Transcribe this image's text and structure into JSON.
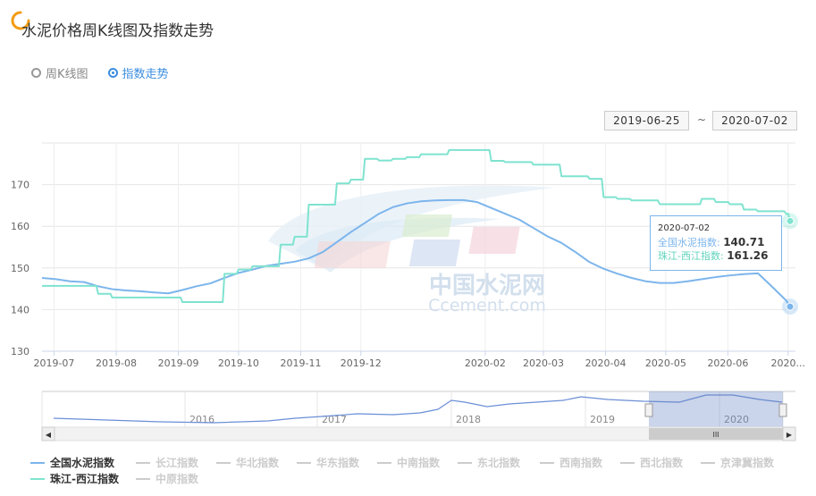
{
  "page": {
    "title": "水泥价格周K线图及指数走势",
    "radios": [
      {
        "label": "周K线图",
        "active": false
      },
      {
        "label": "指数走势",
        "active": true
      }
    ],
    "date_from": "2019-06-25",
    "date_sep": "~",
    "date_to": "2020-07-02"
  },
  "colors": {
    "accent": "#3a8de0",
    "national": "#7cb5ec",
    "zhujiang": "#7fe3cf",
    "inactive": "#cccccc"
  },
  "watermark": {
    "text_cn": "中国水泥网",
    "text_en": "Ccement.com"
  },
  "tooltip": {
    "date": "2020-07-02",
    "rows": [
      {
        "name": "全国水泥指数",
        "value": "140.71"
      },
      {
        "name": "珠江-西江指数",
        "value": "161.26"
      }
    ]
  },
  "navigator": {
    "year_labels": [
      "2016",
      "2017",
      "2018",
      "2019",
      "2020"
    ],
    "scroll_left": "◀",
    "scroll_right": "▶",
    "grip": "III"
  },
  "legend": [
    {
      "label": "全国水泥指数",
      "active": true,
      "color": "#7cb5ec"
    },
    {
      "label": "长江指数",
      "active": false
    },
    {
      "label": "华北指数",
      "active": false
    },
    {
      "label": "华东指数",
      "active": false
    },
    {
      "label": "中南指数",
      "active": false
    },
    {
      "label": "东北指数",
      "active": false
    },
    {
      "label": "西南指数",
      "active": false
    },
    {
      "label": "西北指数",
      "active": false
    },
    {
      "label": "京津冀指数",
      "active": false
    },
    {
      "label": "珠江-西江指数",
      "active": true,
      "color": "#7fe3cf"
    },
    {
      "label": "中原指数",
      "active": false
    }
  ],
  "chart_data": {
    "type": "line",
    "ylim": [
      130,
      180
    ],
    "y_ticks": [
      130,
      140,
      150,
      160,
      170
    ],
    "x_ticks": [
      "2019-07",
      "2019-08",
      "2019-09",
      "2019-10",
      "2019-11",
      "2019-12",
      "2020-02",
      "2020-03",
      "2020-04",
      "2020-05",
      "2020-06",
      "2020..."
    ],
    "series": [
      {
        "name": "全国水泥指数",
        "color": "#7cb5ec",
        "points": [
          [
            "2019-06-25",
            147.6
          ],
          [
            "2019-07-02",
            147.3
          ],
          [
            "2019-07-09",
            146.8
          ],
          [
            "2019-07-16",
            146.6
          ],
          [
            "2019-07-23",
            145.6
          ],
          [
            "2019-07-30",
            144.9
          ],
          [
            "2019-08-06",
            144.6
          ],
          [
            "2019-08-13",
            144.4
          ],
          [
            "2019-08-20",
            144.1
          ],
          [
            "2019-08-27",
            143.9
          ],
          [
            "2019-09-03",
            144.7
          ],
          [
            "2019-09-10",
            145.6
          ],
          [
            "2019-09-17",
            146.3
          ],
          [
            "2019-09-24",
            147.6
          ],
          [
            "2019-10-01",
            148.8
          ],
          [
            "2019-10-08",
            149.6
          ],
          [
            "2019-10-15",
            150.5
          ],
          [
            "2019-10-22",
            151.0
          ],
          [
            "2019-10-29",
            151.5
          ],
          [
            "2019-11-05",
            152.3
          ],
          [
            "2019-11-12",
            153.8
          ],
          [
            "2019-11-19",
            156.2
          ],
          [
            "2019-11-26",
            158.6
          ],
          [
            "2019-12-03",
            160.8
          ],
          [
            "2019-12-10",
            163.0
          ],
          [
            "2019-12-17",
            164.6
          ],
          [
            "2019-12-24",
            165.5
          ],
          [
            "2019-12-31",
            166.0
          ],
          [
            "2020-01-07",
            166.2
          ],
          [
            "2020-01-14",
            166.3
          ],
          [
            "2020-01-21",
            166.3
          ],
          [
            "2020-01-28",
            165.8
          ],
          [
            "2020-02-04",
            164.4
          ],
          [
            "2020-02-11",
            163.0
          ],
          [
            "2020-02-18",
            161.6
          ],
          [
            "2020-02-25",
            159.6
          ],
          [
            "2020-03-03",
            157.6
          ],
          [
            "2020-03-10",
            156.0
          ],
          [
            "2020-03-17",
            153.8
          ],
          [
            "2020-03-24",
            151.4
          ],
          [
            "2020-03-31",
            149.8
          ],
          [
            "2020-04-07",
            148.6
          ],
          [
            "2020-04-14",
            147.6
          ],
          [
            "2020-04-21",
            146.8
          ],
          [
            "2020-04-28",
            146.4
          ],
          [
            "2020-05-05",
            146.4
          ],
          [
            "2020-05-12",
            146.8
          ],
          [
            "2020-05-19",
            147.3
          ],
          [
            "2020-05-26",
            147.8
          ],
          [
            "2020-06-02",
            148.2
          ],
          [
            "2020-06-09",
            148.5
          ],
          [
            "2020-06-16",
            148.7
          ],
          [
            "2020-06-23",
            145.5
          ],
          [
            "2020-06-30",
            142.2
          ],
          [
            "2020-07-02",
            140.71
          ]
        ]
      },
      {
        "name": "珠江-西江指数",
        "color": "#7fe3cf",
        "points": [
          [
            "2019-06-25",
            145.7
          ],
          [
            "2019-07-02",
            145.7
          ],
          [
            "2019-07-09",
            145.7
          ],
          [
            "2019-07-16",
            145.7
          ],
          [
            "2019-07-23",
            143.8
          ],
          [
            "2019-07-30",
            142.9
          ],
          [
            "2019-08-06",
            142.9
          ],
          [
            "2019-08-13",
            142.9
          ],
          [
            "2019-08-20",
            142.9
          ],
          [
            "2019-08-27",
            142.9
          ],
          [
            "2019-09-03",
            141.8
          ],
          [
            "2019-09-10",
            141.8
          ],
          [
            "2019-09-17",
            141.8
          ],
          [
            "2019-09-24",
            148.6
          ],
          [
            "2019-10-01",
            149.6
          ],
          [
            "2019-10-08",
            150.4
          ],
          [
            "2019-10-15",
            150.4
          ],
          [
            "2019-10-22",
            155.6
          ],
          [
            "2019-10-29",
            157.5
          ],
          [
            "2019-11-05",
            165.2
          ],
          [
            "2019-11-12",
            165.2
          ],
          [
            "2019-11-19",
            170.3
          ],
          [
            "2019-11-26",
            171.2
          ],
          [
            "2019-12-03",
            176.2
          ],
          [
            "2019-12-10",
            175.8
          ],
          [
            "2019-12-17",
            176.2
          ],
          [
            "2019-12-24",
            176.6
          ],
          [
            "2019-12-31",
            177.3
          ],
          [
            "2020-01-07",
            177.3
          ],
          [
            "2020-01-14",
            178.3
          ],
          [
            "2020-01-21",
            178.3
          ],
          [
            "2020-01-28",
            178.3
          ],
          [
            "2020-02-04",
            175.7
          ],
          [
            "2020-02-11",
            175.4
          ],
          [
            "2020-02-18",
            175.4
          ],
          [
            "2020-02-25",
            174.8
          ],
          [
            "2020-03-03",
            174.8
          ],
          [
            "2020-03-10",
            172.0
          ],
          [
            "2020-03-17",
            172.0
          ],
          [
            "2020-03-24",
            171.4
          ],
          [
            "2020-03-31",
            167.0
          ],
          [
            "2020-04-07",
            166.6
          ],
          [
            "2020-04-14",
            166.2
          ],
          [
            "2020-04-21",
            166.2
          ],
          [
            "2020-04-28",
            165.3
          ],
          [
            "2020-05-05",
            165.3
          ],
          [
            "2020-05-12",
            165.3
          ],
          [
            "2020-05-19",
            166.6
          ],
          [
            "2020-05-26",
            165.8
          ],
          [
            "2020-06-02",
            165.3
          ],
          [
            "2020-06-09",
            164.0
          ],
          [
            "2020-06-16",
            163.6
          ],
          [
            "2020-06-23",
            163.6
          ],
          [
            "2020-06-30",
            163.0
          ],
          [
            "2020-07-02",
            161.26
          ]
        ]
      }
    ]
  }
}
